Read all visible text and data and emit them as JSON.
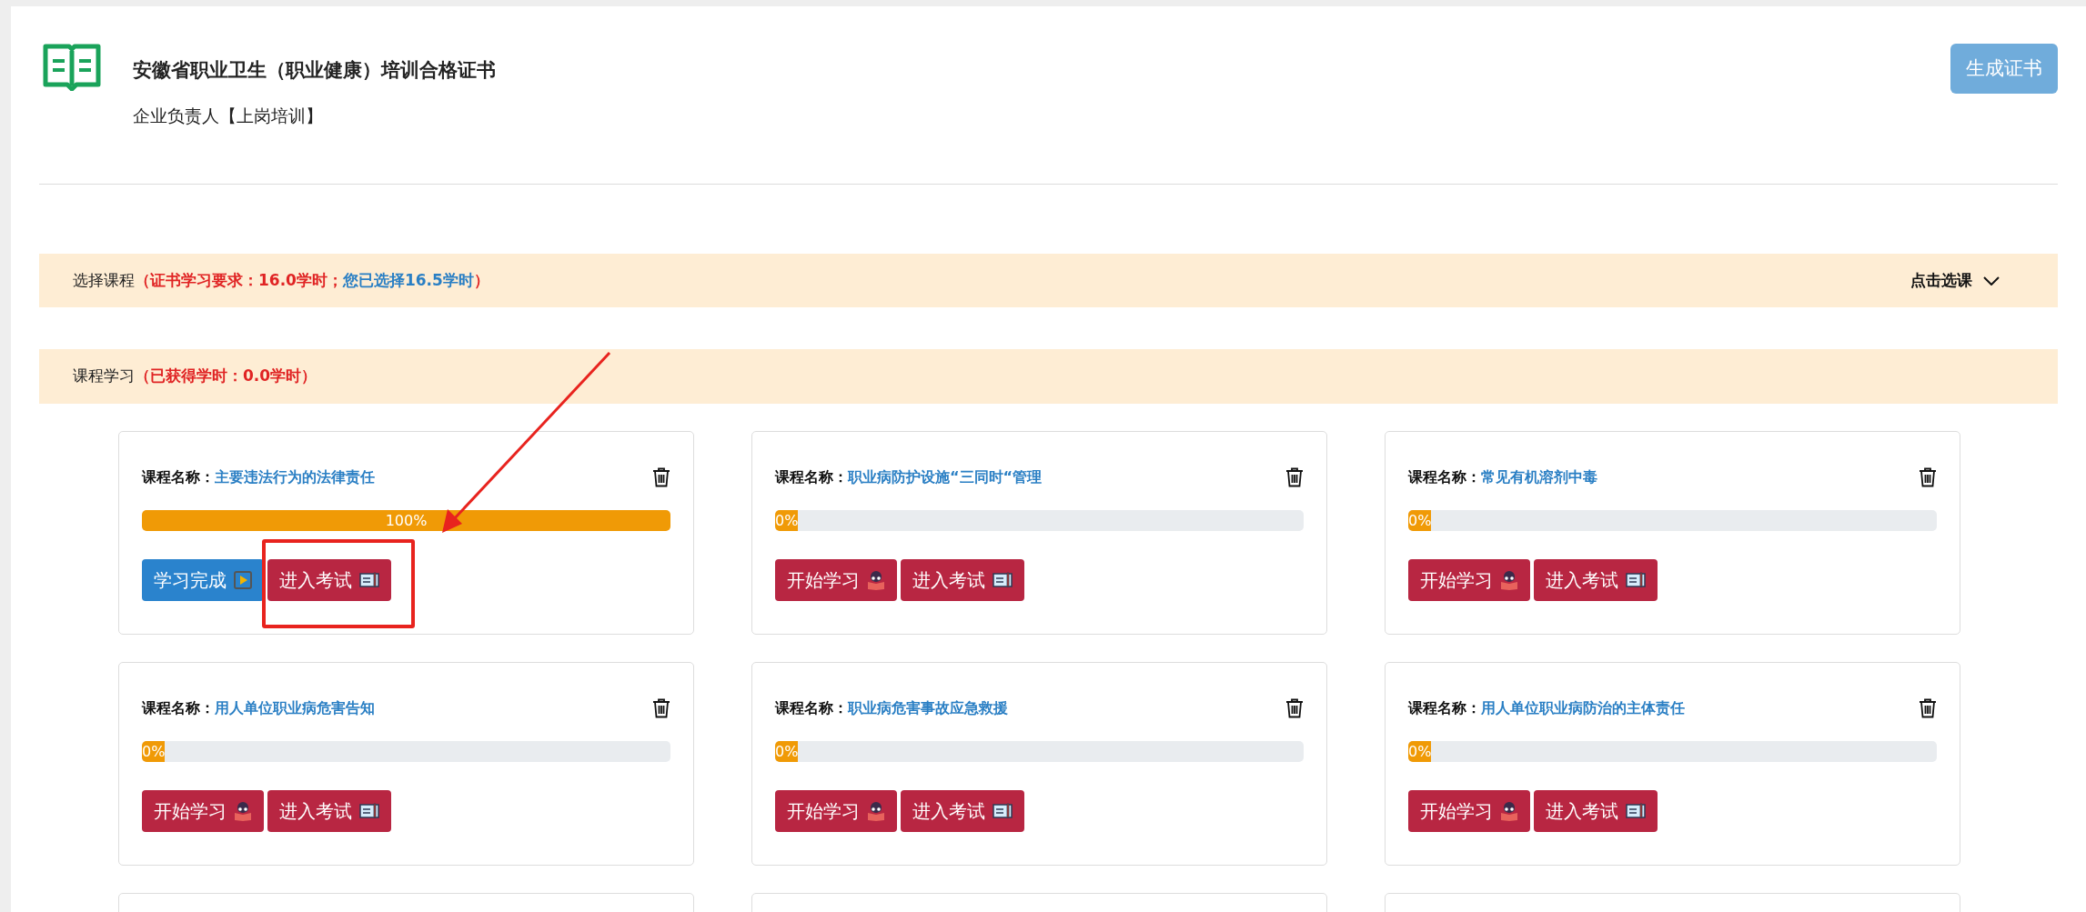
{
  "header": {
    "title": "安徽省职业卫生（职业健康）培训合格证书",
    "subtitle": "企业负责人【上岗培训】",
    "action": "生成证书"
  },
  "select_banner": {
    "label": "选择课程",
    "requirement": "（证书学习要求：16.0学时；",
    "chosen": "您已选择16.5学时",
    "close": "）",
    "toggle": "点击选课"
  },
  "study_banner": {
    "label": "课程学习",
    "earned": "（已获得学时：0.0学时）"
  },
  "courses": [
    {
      "name_label": "课程名称：",
      "name": "主要违法行为的法律责任",
      "level": 1,
      "progress": "100%",
      "buttons": [
        {
          "kind": "complete",
          "label": "学习完成"
        },
        {
          "kind": "exam",
          "label": "进入考试",
          "highlighted": true
        }
      ]
    },
    {
      "name_label": "课程名称：",
      "name": "职业病防护设施“三同时“管理",
      "level": 0,
      "progress": "0%",
      "buttons": [
        {
          "kind": "study",
          "label": "开始学习"
        },
        {
          "kind": "exam",
          "label": "进入考试",
          "highlighted": false
        }
      ]
    },
    {
      "name_label": "课程名称：",
      "name": "常见有机溶剂中毒",
      "level": 0,
      "progress": "0%",
      "buttons": [
        {
          "kind": "study",
          "label": "开始学习"
        },
        {
          "kind": "exam",
          "label": "进入考试",
          "highlighted": false
        }
      ]
    },
    {
      "name_label": "课程名称：",
      "name": "用人单位职业病危害告知",
      "level": 0,
      "progress": "0%",
      "buttons": [
        {
          "kind": "study",
          "label": "开始学习"
        },
        {
          "kind": "exam",
          "label": "进入考试",
          "highlighted": false
        }
      ]
    },
    {
      "name_label": "课程名称：",
      "name": "职业病危害事故应急救援",
      "level": 0,
      "progress": "0%",
      "buttons": [
        {
          "kind": "study",
          "label": "开始学习"
        },
        {
          "kind": "exam",
          "label": "进入考试",
          "highlighted": false
        }
      ]
    },
    {
      "name_label": "课程名称：",
      "name": "用人单位职业病防治的主体责任",
      "level": 0,
      "progress": "0%",
      "buttons": [
        {
          "kind": "study",
          "label": "开始学习"
        },
        {
          "kind": "exam",
          "label": "进入考试",
          "highlighted": false
        }
      ]
    }
  ]
}
